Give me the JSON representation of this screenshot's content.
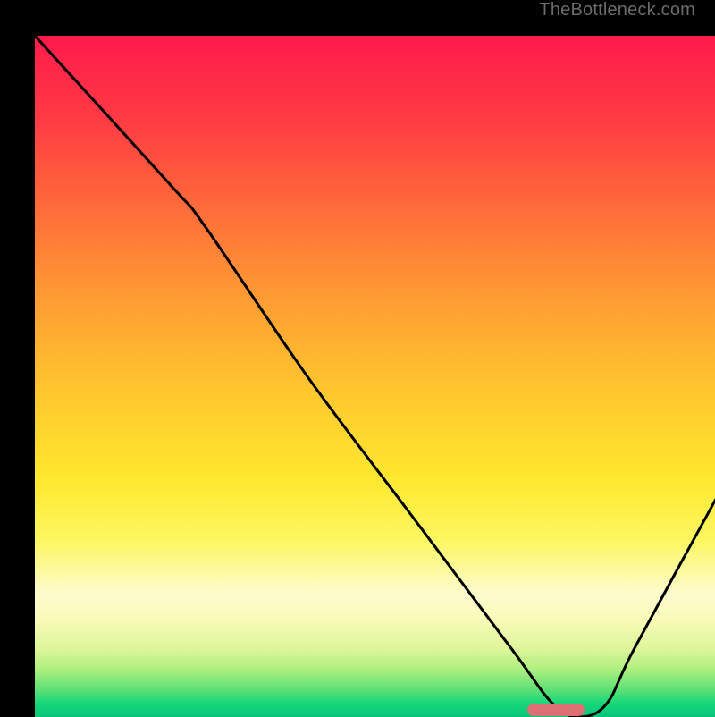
{
  "watermark": "TheBottleneck.com",
  "chart_data": {
    "type": "line",
    "title": "",
    "xlabel": "",
    "ylabel": "",
    "xlim": [
      0,
      100
    ],
    "ylim": [
      0,
      100
    ],
    "grid": false,
    "legend": false,
    "series": [
      {
        "name": "bottleneck-curve",
        "x": [
          0,
          20,
          25,
          40,
          55,
          70,
          76,
          80,
          84,
          88,
          100
        ],
        "values": [
          100,
          78,
          72,
          50,
          30,
          10,
          2,
          0,
          2,
          10,
          32
        ]
      }
    ],
    "marker": {
      "name": "optimal-range",
      "x_center": 76.5,
      "y": 1,
      "width_pct": 8.4
    },
    "background_gradient": {
      "stops": [
        {
          "pct": 0,
          "color": "#ff1a4b"
        },
        {
          "pct": 25,
          "color": "#ff6a3a"
        },
        {
          "pct": 50,
          "color": "#ffc62e"
        },
        {
          "pct": 75,
          "color": "#fcf760"
        },
        {
          "pct": 90,
          "color": "#ddf69a"
        },
        {
          "pct": 100,
          "color": "#09c47a"
        }
      ]
    }
  }
}
